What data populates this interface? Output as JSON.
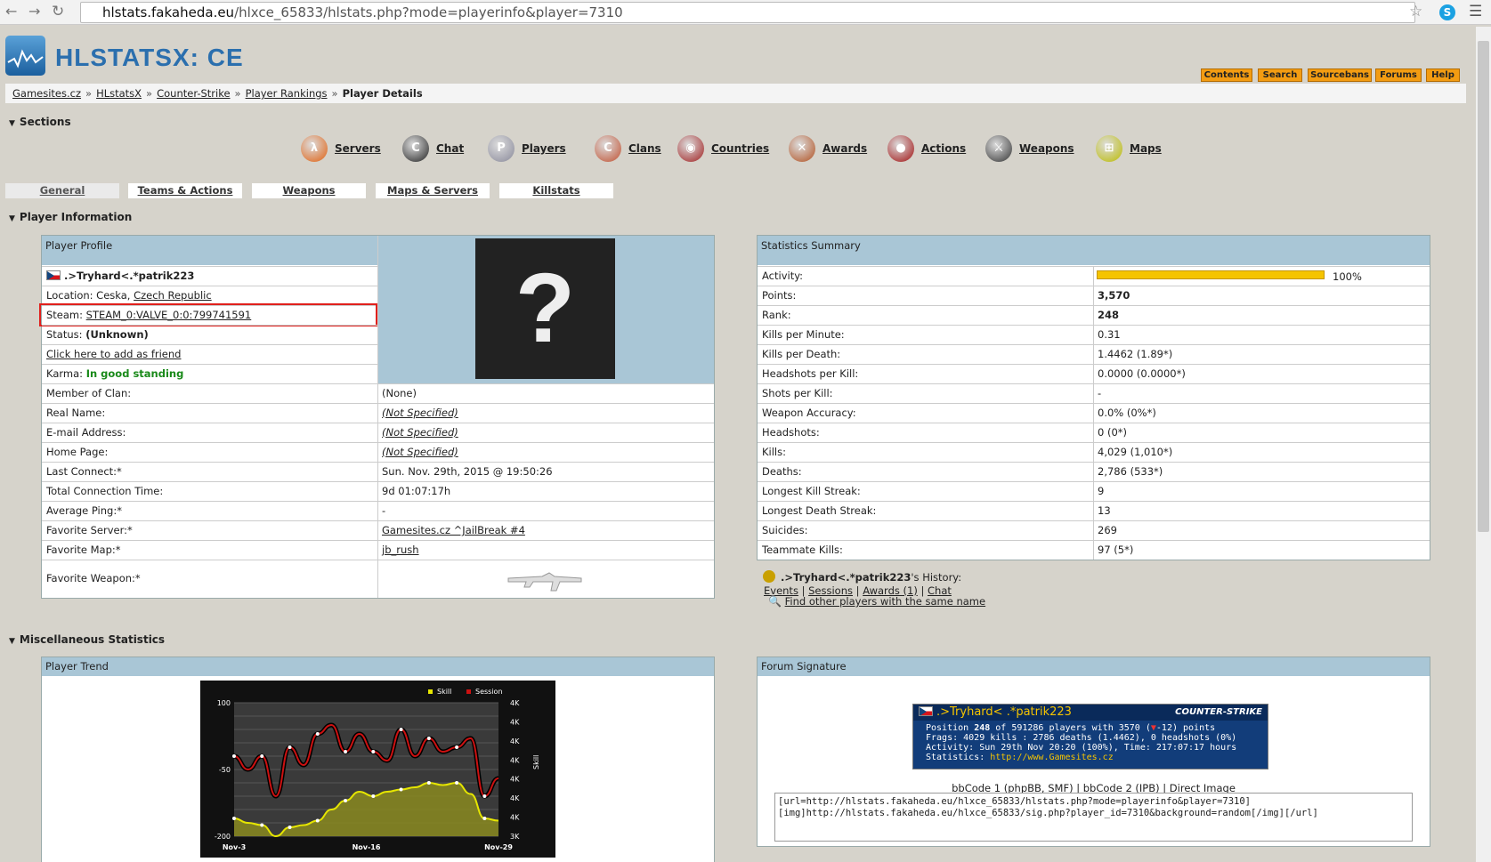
{
  "browser": {
    "url_domain": "hlstats.fakaheda.eu",
    "url_path": "/hlxce_65833/hlstats.php?mode=playerinfo&player=7310"
  },
  "header": {
    "logo_text": "HLSTATSX: CE",
    "top_links": [
      "Contents",
      "Search",
      "Sourcebans",
      "Forums",
      "Help"
    ]
  },
  "breadcrumb": [
    "Gamesites.cz",
    "HLstatsX",
    "Counter-Strike",
    "Player Rankings"
  ],
  "breadcrumb_current": "Player Details",
  "sections_title": "Sections",
  "sections": [
    "Servers",
    "Chat",
    "Players",
    "Clans",
    "Countries",
    "Awards",
    "Actions",
    "Weapons",
    "Maps"
  ],
  "tabs": [
    "General",
    "Teams & Actions",
    "Weapons",
    "Maps & Servers",
    "Killstats"
  ],
  "player_info_title": "Player Information",
  "profile": {
    "header": "Player Profile",
    "name": ".>Tryhard<.*patrik223",
    "location_label": "Location:",
    "location_city": "Ceska,",
    "location_country": "Czech Republic",
    "steam_label": "Steam:",
    "steam_id": "STEAM_0:VALVE_0:0:799741591",
    "status_label": "Status:",
    "status_value": "(Unknown)",
    "friend_link": "Click here to add as friend",
    "karma_label": "Karma:",
    "karma_value": "In good standing",
    "avatar_glyph": "?",
    "rows": [
      {
        "label": "Member of Clan:",
        "value": "(None)"
      },
      {
        "label": "Real Name:",
        "value": "(Not Specified)"
      },
      {
        "label": "E-mail Address:",
        "value": "(Not Specified)"
      },
      {
        "label": "Home Page:",
        "value": "(Not Specified)"
      },
      {
        "label": "Last Connect:*",
        "value": "Sun. Nov. 29th, 2015 @ 19:50:26"
      },
      {
        "label": "Total Connection Time:",
        "value": "9d 01:07:17h"
      },
      {
        "label": "Average Ping:*",
        "value": "-"
      },
      {
        "label": "Favorite Server:*",
        "value": "Gamesites.cz ^JailBreak #4"
      },
      {
        "label": "Favorite Map:*",
        "value": "jb_rush"
      },
      {
        "label": "Favorite Weapon:*",
        "value": ""
      }
    ]
  },
  "summary": {
    "header": "Statistics Summary",
    "activity_label": "Activity:",
    "activity_percent": 100,
    "activity_text": "100%",
    "rows": [
      {
        "label": "Points:",
        "value": "3,570",
        "bold": true
      },
      {
        "label": "Rank:",
        "value": "248",
        "bold": true
      },
      {
        "label": "Kills per Minute:",
        "value": "0.31"
      },
      {
        "label": "Kills per Death:",
        "value": "1.4462 (1.89*)"
      },
      {
        "label": "Headshots per Kill:",
        "value": "0.0000 (0.0000*)"
      },
      {
        "label": "Shots per Kill:",
        "value": "-"
      },
      {
        "label": "Weapon Accuracy:",
        "value": "0.0% (0%*)"
      },
      {
        "label": "Headshots:",
        "value": "0 (0*)"
      },
      {
        "label": "Kills:",
        "value": "4,029 (1,010*)"
      },
      {
        "label": "Deaths:",
        "value": "2,786 (533*)"
      },
      {
        "label": "Longest Kill Streak:",
        "value": "9"
      },
      {
        "label": "Longest Death Streak:",
        "value": "13"
      },
      {
        "label": "Suicides:",
        "value": "269"
      },
      {
        "label": "Teammate Kills:",
        "value": "97 (5*)"
      }
    ]
  },
  "history": {
    "name": ".>Tryhard<.*patrik223",
    "suffix": "'s History:",
    "links": [
      "Events",
      "Sessions",
      "Awards (1)",
      "Chat"
    ],
    "find_link": "Find other players with the same name"
  },
  "misc_title": "Miscellaneous Statistics",
  "trend": {
    "header": "Player Trend"
  },
  "chart_data": {
    "type": "line",
    "categories": [
      "Nov-3",
      "Nov-16",
      "Nov-29"
    ],
    "legend": [
      "Skill",
      "Session"
    ],
    "left_ticks": [
      "100",
      "-50",
      "-200"
    ],
    "right_ticks": [
      "4K",
      "4K",
      "4K",
      "4K",
      "4K",
      "4K",
      "4K",
      "3K"
    ],
    "right_axis_label": "Skill",
    "series": [
      {
        "name": "Session",
        "color": "#cc1111",
        "values": [
          -20,
          -50,
          -20,
          -110,
          0,
          -40,
          30,
          50,
          -10,
          30,
          -10,
          -30,
          40,
          -20,
          20,
          -10,
          0,
          20,
          -110,
          -70
        ]
      },
      {
        "name": "Skill",
        "color": "#e6e600",
        "values": [
          -160,
          -170,
          -175,
          -200,
          -180,
          -175,
          -165,
          -140,
          -120,
          -100,
          -110,
          -100,
          -95,
          -90,
          -80,
          -85,
          -80,
          -105,
          -160,
          -165
        ]
      }
    ],
    "ylim": [
      -200,
      100
    ]
  },
  "signature": {
    "header": "Forum Signature",
    "name": ".>Tryhard< .*patrik223",
    "game_logo": "COUNTER-STRIKE",
    "line1_a": "Position ",
    "line1_rank": "248",
    "line1_b": " of 591286 players with 3570 (",
    "line1_c": "-12) points",
    "line2": "Frags: 4029 kills : 2786 deaths (1.4462), 0 headshots (0%)",
    "line3": "Activity: Sun 29th Nov 20:20 (100%), Time: 217:07:17 hours",
    "line4_a": "Statistics: ",
    "line4_url": "http://www.Gamesites.cz",
    "links": [
      "bbCode 1 (phpBB, SMF)",
      "bbCode 2 (IPB)",
      "Direct Image"
    ],
    "code": "[url=http://hlstats.fakaheda.eu/hlxce_65833/hlstats.php?mode=playerinfo&player=7310]\n[img]http://hlstats.fakaheda.eu/hlxce_65833/sig.php?player_id=7310&background=random[/img][/url]"
  }
}
